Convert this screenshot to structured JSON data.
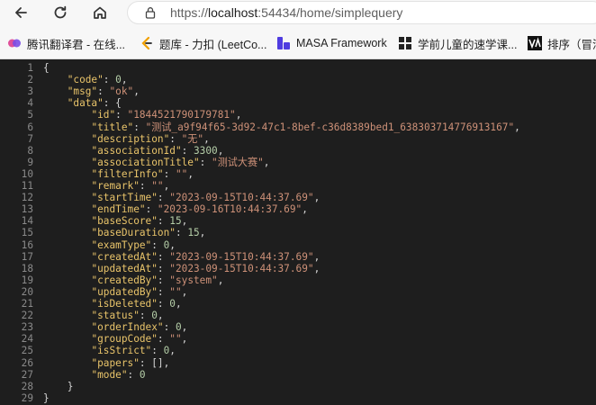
{
  "browser": {
    "url_scheme": "https://",
    "url_host": "localhost",
    "url_rest": ":54434/home/simplequery"
  },
  "bookmarks": [
    {
      "label": "腾讯翻译君 - 在线...",
      "icon": "tencent-translate-icon"
    },
    {
      "label": "题库 - 力扣 (LeetCo...",
      "icon": "leetcode-icon"
    },
    {
      "label": "MASA Framework",
      "icon": "masa-icon"
    },
    {
      "label": "学前儿童的速学课...",
      "icon": "app-grid-icon"
    },
    {
      "label": "排序（冒泡",
      "icon": "va-icon"
    }
  ],
  "json_lines": [
    {
      "num": "1",
      "tokens": [
        {
          "t": "{",
          "c": "p"
        }
      ]
    },
    {
      "num": "2",
      "tokens": [
        {
          "t": "    ",
          "c": "p"
        },
        {
          "t": "\"code\"",
          "c": "k"
        },
        {
          "t": ": ",
          "c": "p"
        },
        {
          "t": "0",
          "c": "n"
        },
        {
          "t": ",",
          "c": "p"
        }
      ]
    },
    {
      "num": "3",
      "tokens": [
        {
          "t": "    ",
          "c": "p"
        },
        {
          "t": "\"msg\"",
          "c": "k"
        },
        {
          "t": ": ",
          "c": "p"
        },
        {
          "t": "\"ok\"",
          "c": "s"
        },
        {
          "t": ",",
          "c": "p"
        }
      ]
    },
    {
      "num": "4",
      "tokens": [
        {
          "t": "    ",
          "c": "p"
        },
        {
          "t": "\"data\"",
          "c": "k"
        },
        {
          "t": ": {",
          "c": "p"
        }
      ]
    },
    {
      "num": "5",
      "tokens": [
        {
          "t": "        ",
          "c": "p"
        },
        {
          "t": "\"id\"",
          "c": "k"
        },
        {
          "t": ": ",
          "c": "p"
        },
        {
          "t": "\"1844521790179781\"",
          "c": "s"
        },
        {
          "t": ",",
          "c": "p"
        }
      ]
    },
    {
      "num": "6",
      "tokens": [
        {
          "t": "        ",
          "c": "p"
        },
        {
          "t": "\"title\"",
          "c": "k"
        },
        {
          "t": ": ",
          "c": "p"
        },
        {
          "t": "\"测试_a9f94f65-3d92-47c1-8bef-c36d8389bed1_638303714776913167\"",
          "c": "s"
        },
        {
          "t": ",",
          "c": "p"
        }
      ]
    },
    {
      "num": "7",
      "tokens": [
        {
          "t": "        ",
          "c": "p"
        },
        {
          "t": "\"description\"",
          "c": "k"
        },
        {
          "t": ": ",
          "c": "p"
        },
        {
          "t": "\"无\"",
          "c": "s"
        },
        {
          "t": ",",
          "c": "p"
        }
      ]
    },
    {
      "num": "8",
      "tokens": [
        {
          "t": "        ",
          "c": "p"
        },
        {
          "t": "\"associationId\"",
          "c": "k"
        },
        {
          "t": ": ",
          "c": "p"
        },
        {
          "t": "3300",
          "c": "n"
        },
        {
          "t": ",",
          "c": "p"
        }
      ]
    },
    {
      "num": "9",
      "tokens": [
        {
          "t": "        ",
          "c": "p"
        },
        {
          "t": "\"associationTitle\"",
          "c": "k"
        },
        {
          "t": ": ",
          "c": "p"
        },
        {
          "t": "\"测试大赛\"",
          "c": "s"
        },
        {
          "t": ",",
          "c": "p"
        }
      ]
    },
    {
      "num": "10",
      "tokens": [
        {
          "t": "        ",
          "c": "p"
        },
        {
          "t": "\"filterInfo\"",
          "c": "k"
        },
        {
          "t": ": ",
          "c": "p"
        },
        {
          "t": "\"\"",
          "c": "s"
        },
        {
          "t": ",",
          "c": "p"
        }
      ]
    },
    {
      "num": "11",
      "tokens": [
        {
          "t": "        ",
          "c": "p"
        },
        {
          "t": "\"remark\"",
          "c": "k"
        },
        {
          "t": ": ",
          "c": "p"
        },
        {
          "t": "\"\"",
          "c": "s"
        },
        {
          "t": ",",
          "c": "p"
        }
      ]
    },
    {
      "num": "12",
      "tokens": [
        {
          "t": "        ",
          "c": "p"
        },
        {
          "t": "\"startTime\"",
          "c": "k"
        },
        {
          "t": ": ",
          "c": "p"
        },
        {
          "t": "\"2023-09-15T10:44:37.69\"",
          "c": "s"
        },
        {
          "t": ",",
          "c": "p"
        }
      ]
    },
    {
      "num": "13",
      "tokens": [
        {
          "t": "        ",
          "c": "p"
        },
        {
          "t": "\"endTime\"",
          "c": "k"
        },
        {
          "t": ": ",
          "c": "p"
        },
        {
          "t": "\"2023-09-16T10:44:37.69\"",
          "c": "s"
        },
        {
          "t": ",",
          "c": "p"
        }
      ]
    },
    {
      "num": "14",
      "tokens": [
        {
          "t": "        ",
          "c": "p"
        },
        {
          "t": "\"baseScore\"",
          "c": "k"
        },
        {
          "t": ": ",
          "c": "p"
        },
        {
          "t": "15",
          "c": "n"
        },
        {
          "t": ",",
          "c": "p"
        }
      ]
    },
    {
      "num": "15",
      "tokens": [
        {
          "t": "        ",
          "c": "p"
        },
        {
          "t": "\"baseDuration\"",
          "c": "k"
        },
        {
          "t": ": ",
          "c": "p"
        },
        {
          "t": "15",
          "c": "n"
        },
        {
          "t": ",",
          "c": "p"
        }
      ]
    },
    {
      "num": "16",
      "tokens": [
        {
          "t": "        ",
          "c": "p"
        },
        {
          "t": "\"examType\"",
          "c": "k"
        },
        {
          "t": ": ",
          "c": "p"
        },
        {
          "t": "0",
          "c": "n"
        },
        {
          "t": ",",
          "c": "p"
        }
      ]
    },
    {
      "num": "17",
      "tokens": [
        {
          "t": "        ",
          "c": "p"
        },
        {
          "t": "\"createdAt\"",
          "c": "k"
        },
        {
          "t": ": ",
          "c": "p"
        },
        {
          "t": "\"2023-09-15T10:44:37.69\"",
          "c": "s"
        },
        {
          "t": ",",
          "c": "p"
        }
      ]
    },
    {
      "num": "18",
      "tokens": [
        {
          "t": "        ",
          "c": "p"
        },
        {
          "t": "\"updatedAt\"",
          "c": "k"
        },
        {
          "t": ": ",
          "c": "p"
        },
        {
          "t": "\"2023-09-15T10:44:37.69\"",
          "c": "s"
        },
        {
          "t": ",",
          "c": "p"
        }
      ]
    },
    {
      "num": "19",
      "tokens": [
        {
          "t": "        ",
          "c": "p"
        },
        {
          "t": "\"createdBy\"",
          "c": "k"
        },
        {
          "t": ": ",
          "c": "p"
        },
        {
          "t": "\"system\"",
          "c": "s"
        },
        {
          "t": ",",
          "c": "p"
        }
      ]
    },
    {
      "num": "20",
      "tokens": [
        {
          "t": "        ",
          "c": "p"
        },
        {
          "t": "\"updatedBy\"",
          "c": "k"
        },
        {
          "t": ": ",
          "c": "p"
        },
        {
          "t": "\"\"",
          "c": "s"
        },
        {
          "t": ",",
          "c": "p"
        }
      ]
    },
    {
      "num": "21",
      "tokens": [
        {
          "t": "        ",
          "c": "p"
        },
        {
          "t": "\"isDeleted\"",
          "c": "k"
        },
        {
          "t": ": ",
          "c": "p"
        },
        {
          "t": "0",
          "c": "n"
        },
        {
          "t": ",",
          "c": "p"
        }
      ]
    },
    {
      "num": "22",
      "tokens": [
        {
          "t": "        ",
          "c": "p"
        },
        {
          "t": "\"status\"",
          "c": "k"
        },
        {
          "t": ": ",
          "c": "p"
        },
        {
          "t": "0",
          "c": "n"
        },
        {
          "t": ",",
          "c": "p"
        }
      ]
    },
    {
      "num": "23",
      "tokens": [
        {
          "t": "        ",
          "c": "p"
        },
        {
          "t": "\"orderIndex\"",
          "c": "k"
        },
        {
          "t": ": ",
          "c": "p"
        },
        {
          "t": "0",
          "c": "n"
        },
        {
          "t": ",",
          "c": "p"
        }
      ]
    },
    {
      "num": "24",
      "tokens": [
        {
          "t": "        ",
          "c": "p"
        },
        {
          "t": "\"groupCode\"",
          "c": "k"
        },
        {
          "t": ": ",
          "c": "p"
        },
        {
          "t": "\"\"",
          "c": "s"
        },
        {
          "t": ",",
          "c": "p"
        }
      ]
    },
    {
      "num": "25",
      "tokens": [
        {
          "t": "        ",
          "c": "p"
        },
        {
          "t": "\"isStrict\"",
          "c": "k"
        },
        {
          "t": ": ",
          "c": "p"
        },
        {
          "t": "0",
          "c": "n"
        },
        {
          "t": ",",
          "c": "p"
        }
      ]
    },
    {
      "num": "26",
      "tokens": [
        {
          "t": "        ",
          "c": "p"
        },
        {
          "t": "\"papers\"",
          "c": "k"
        },
        {
          "t": ": ",
          "c": "p"
        },
        {
          "t": "[]",
          "c": "p"
        },
        {
          "t": ",",
          "c": "p"
        }
      ]
    },
    {
      "num": "27",
      "tokens": [
        {
          "t": "        ",
          "c": "p"
        },
        {
          "t": "\"mode\"",
          "c": "k"
        },
        {
          "t": ": ",
          "c": "p"
        },
        {
          "t": "0",
          "c": "n"
        }
      ]
    },
    {
      "num": "28",
      "tokens": [
        {
          "t": "    }",
          "c": "p"
        }
      ]
    },
    {
      "num": "29",
      "tokens": [
        {
          "t": "}",
          "c": "p"
        }
      ]
    }
  ]
}
